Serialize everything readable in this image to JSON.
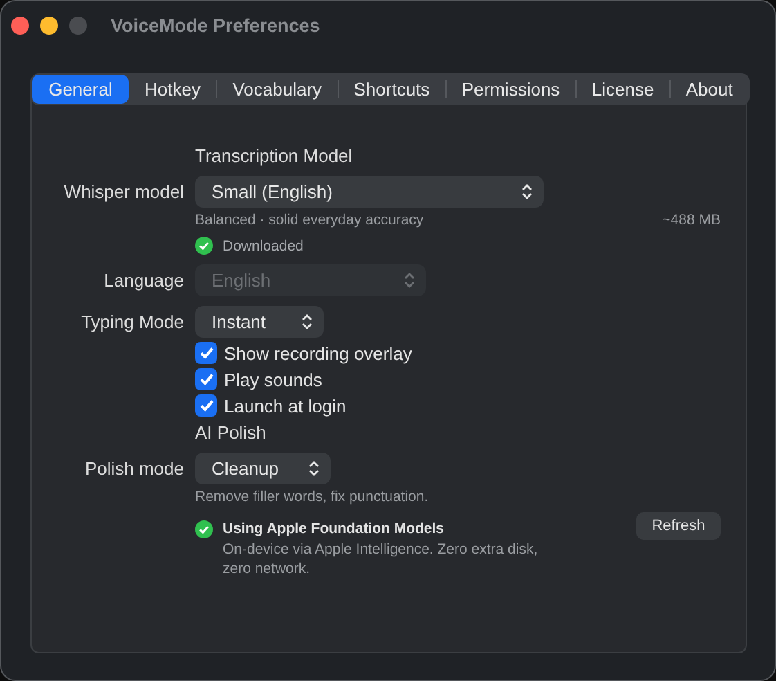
{
  "window": {
    "title": "VoiceMode Preferences"
  },
  "tabs": [
    {
      "label": "General",
      "selected": true
    },
    {
      "label": "Hotkey",
      "selected": false
    },
    {
      "label": "Vocabulary",
      "selected": false
    },
    {
      "label": "Shortcuts",
      "selected": false
    },
    {
      "label": "Permissions",
      "selected": false
    },
    {
      "label": "License",
      "selected": false
    },
    {
      "label": "About",
      "selected": false
    }
  ],
  "items": [
    {
      "kind": "heading",
      "text": "Transcription Model"
    },
    {
      "kind": "select",
      "label": "Whisper model",
      "value": "Small (English)",
      "disabled": false
    },
    {
      "kind": "caption",
      "text": "Balanced · solid everyday accuracy",
      "aside": "~488 MB"
    },
    {
      "kind": "status",
      "text": "Downloaded",
      "ok": true
    },
    {
      "kind": "select",
      "label": "Language",
      "value": "English",
      "disabled": true
    },
    {
      "kind": "select",
      "label": "Typing Mode",
      "value": "Instant",
      "disabled": false
    },
    {
      "kind": "checkbox",
      "text": "Show recording overlay",
      "checked": true
    },
    {
      "kind": "checkbox",
      "text": "Play sounds",
      "checked": true
    },
    {
      "kind": "checkbox",
      "text": "Launch at login",
      "checked": true
    },
    {
      "kind": "heading",
      "text": "AI Polish"
    },
    {
      "kind": "select",
      "label": "Polish mode",
      "value": "Cleanup",
      "disabled": false
    },
    {
      "kind": "caption",
      "text": "Remove filler words, fix punctuation."
    },
    {
      "kind": "provider",
      "title": "Using Apple Foundation Models",
      "detail": "On-device via Apple Intelligence. Zero extra disk, zero network.",
      "ok": true,
      "button": "Refresh"
    }
  ]
}
